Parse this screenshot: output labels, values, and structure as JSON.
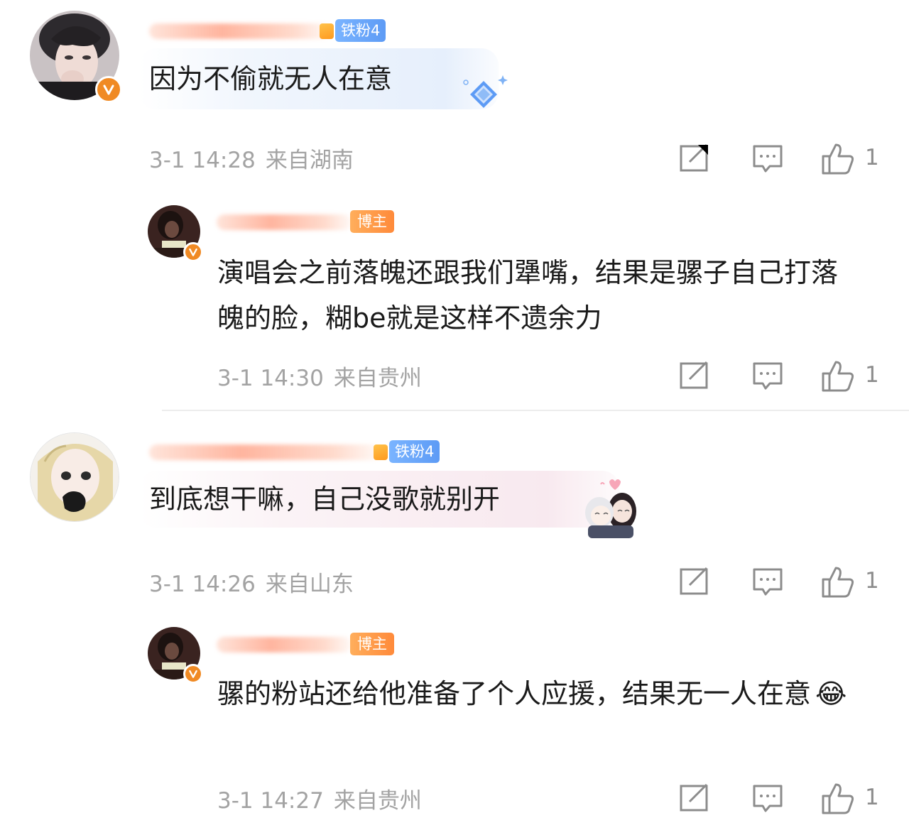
{
  "comments": [
    {
      "badge": "铁粉4",
      "text": "因为不偷就无人在意",
      "time": "3-1 14:28",
      "location": "来自湖南",
      "likes": "1",
      "bubble_color": "#e6effc"
    },
    {
      "badge": "博主",
      "text": "演唱会之前落魄还跟我们犟嘴，结果是骡子自己打落魄的脸，糊be就是这样不遗余力",
      "time": "3-1 14:30",
      "location": "来自贵州",
      "likes": "1"
    },
    {
      "badge": "铁粉4",
      "text": "到底想干嘛，自己没歌就别开",
      "time": "3-1 14:26",
      "location": "来自山东",
      "likes": "1",
      "bubble_color": "#f8e9ef"
    },
    {
      "badge": "博主",
      "text": "骡的粉站还给他准备了个人应援，结果无一人在意",
      "emoji": "😂",
      "time": "3-1 14:27",
      "location": "来自贵州",
      "likes": "1"
    }
  ],
  "colors": {
    "fan_badge": "#5d9bf5",
    "host_badge": "#ff8a3a",
    "verified": "#f08a24",
    "meta_text": "#a3a3a3"
  },
  "icons": [
    "repost-icon",
    "comment-icon",
    "like-icon",
    "verified-v-icon"
  ]
}
